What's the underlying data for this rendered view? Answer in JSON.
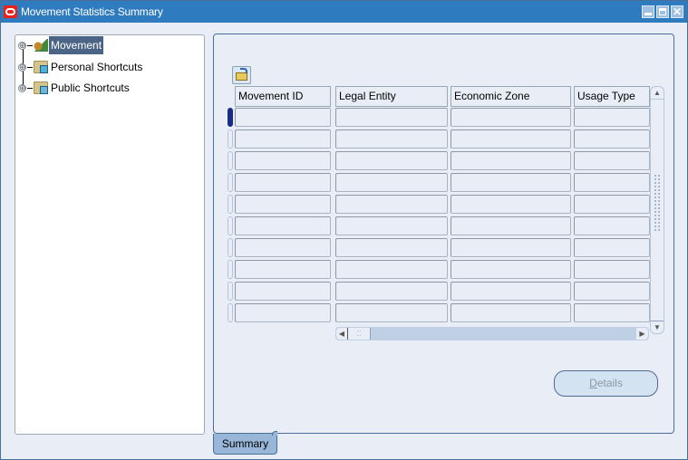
{
  "window": {
    "title": "Movement Statistics Summary",
    "controls": [
      "minimize",
      "maximize",
      "close"
    ],
    "close_glyph": "✕"
  },
  "tree": {
    "items": [
      {
        "label": "Movement",
        "icon": "movement-icon",
        "selected": true,
        "expander": "⊕"
      },
      {
        "label": "Personal Shortcuts",
        "icon": "personal-folder-icon",
        "selected": false,
        "expander": "⊕"
      },
      {
        "label": "Public Shortcuts",
        "icon": "public-folder-icon",
        "selected": false,
        "expander": "⊕"
      }
    ]
  },
  "grid": {
    "columns": [
      "Movement ID",
      "Legal Entity",
      "Economic Zone",
      "Usage Type"
    ],
    "row_count": 10,
    "rows": [
      [
        "",
        "",
        "",
        ""
      ],
      [
        "",
        "",
        "",
        ""
      ],
      [
        "",
        "",
        "",
        ""
      ],
      [
        "",
        "",
        "",
        ""
      ],
      [
        "",
        "",
        "",
        ""
      ],
      [
        "",
        "",
        "",
        ""
      ],
      [
        "",
        "",
        "",
        ""
      ],
      [
        "",
        "",
        "",
        ""
      ],
      [
        "",
        "",
        "",
        ""
      ],
      [
        "",
        "",
        "",
        ""
      ]
    ],
    "current_row": 1
  },
  "toolbar": {
    "open_icon": "open-folder-icon"
  },
  "scroll": {
    "up": "▲",
    "down": "▼",
    "left": "◀",
    "right": "▶",
    "grip": "⁚⁚"
  },
  "buttons": {
    "details_mnemonic": "D",
    "details_rest": "etails",
    "details_enabled": false
  },
  "tabs": [
    {
      "label": "Summary",
      "active": true
    }
  ]
}
